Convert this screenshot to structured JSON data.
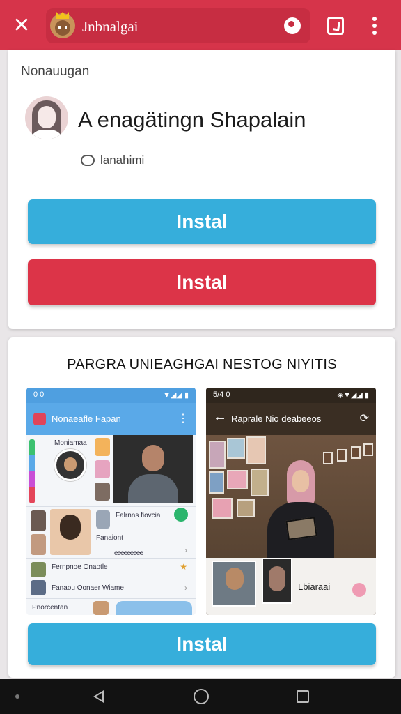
{
  "browser": {
    "url_text": "Jnbnalgai",
    "close_label": "✕",
    "menu_label": "⋮"
  },
  "card_app": {
    "subtitle": "Nonauugan",
    "app_name": "A enagätingn Shapalain",
    "meta_text": "lanahimi",
    "install_primary": "Instal",
    "install_secondary": "Instal"
  },
  "card_screens": {
    "heading": "PARGRA UNIEAGHGAI  NESTOG NIYITIS",
    "install_label": "Instal",
    "screen_a": {
      "status_left": "0 0",
      "status_right": "▼◢◢ ▮",
      "title": "Nonaeafle Fapan",
      "labels": [
        "Moniamaa",
        "Falrnns fiovcia",
        "Fanaiont",
        "Fernpnoe Onaotle",
        "Fanaou Oonaer Wiame",
        "Pnorcentan"
      ],
      "counter": "eeeeeeeee"
    },
    "screen_b": {
      "status_left": "5/4 0",
      "status_right": "◈▼◢◢ ▮",
      "title": "Raprale Nio deabeeos",
      "caption": "Lbiaraai"
    }
  },
  "colors": {
    "brand_red": "#d6344a",
    "install_blue": "#36aedb",
    "install_red": "#dc3448"
  },
  "icons": [
    "close-icon",
    "favicon-icon",
    "reload-icon",
    "tabs-icon",
    "overflow-menu-icon",
    "chat-icon",
    "back-nav-icon",
    "home-nav-icon",
    "recents-nav-icon"
  ]
}
